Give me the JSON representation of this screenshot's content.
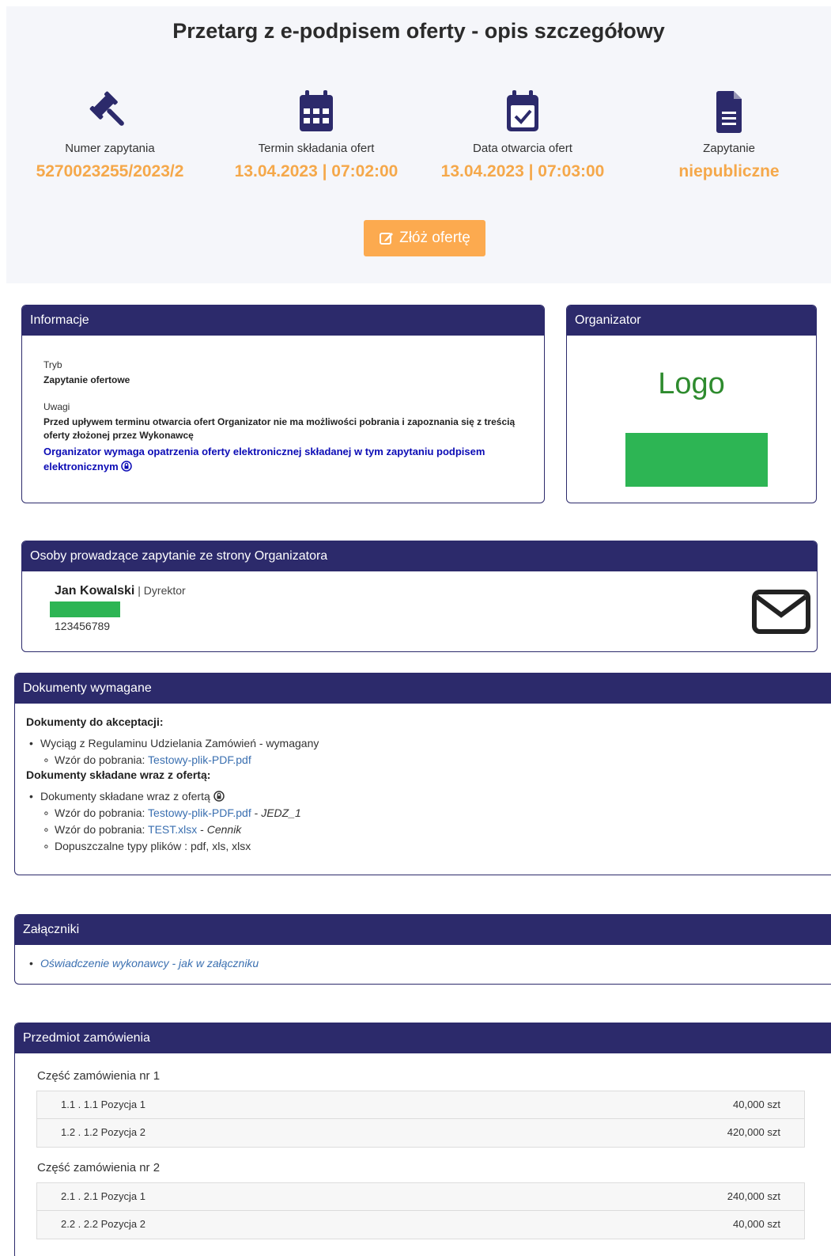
{
  "header": {
    "title": "Przetarg z e-podpisem oferty - opis szczegółowy",
    "stats": [
      {
        "icon": "gavel-icon",
        "label": "Numer zapytania",
        "value": "5270023255/2023/2"
      },
      {
        "icon": "calendar-icon",
        "label": "Termin składania ofert",
        "value": "13.04.2023 | 07:02:00"
      },
      {
        "icon": "calendar-check-icon",
        "label": "Data otwarcia ofert",
        "value": "13.04.2023 | 07:03:00"
      },
      {
        "icon": "document-icon",
        "label": "Zapytanie",
        "value": "niepubliczne"
      }
    ],
    "offer_button": "Złóż ofertę",
    "accent_color": "#f5a84a"
  },
  "info": {
    "title": "Informacje",
    "mode_label": "Tryb",
    "mode_value": "Zapytanie ofertowe",
    "notes_label": "Uwagi",
    "notes_line1": "Przed upływem terminu otwarcia ofert Organizator nie ma możliwości pobrania i zapoznania się z treścią",
    "notes_line2": "oferty złożonej przez Wykonawcę",
    "signature_line1": "Organizator wymaga opatrzenia oferty elektronicznej składanej w tym zapytaniu podpisem",
    "signature_line2": "elektronicznym"
  },
  "organizer": {
    "title": "Organizator",
    "logo_text": "Logo"
  },
  "contacts": {
    "title": "Osoby prowadzące zapytanie ze strony Organizatora",
    "name": "Jan Kowalski",
    "separator": " | ",
    "role": "Dyrektor",
    "phone": "123456789"
  },
  "documents": {
    "title": "Dokumenty wymagane",
    "accept_heading": "Dokumenty do akceptacji:",
    "accept_item": "Wyciąg z Regulaminu Udzielania Zamówień - wymagany",
    "template_prefix": "Wzór do pobrania: ",
    "accept_file": "Testowy-plik-PDF.pdf",
    "with_offer_heading": "Dokumenty składane wraz z ofertą:",
    "with_offer_item": "Dokumenty składane wraz z ofertą",
    "file1": "Testowy-plik-PDF.pdf",
    "file1_desc": "JEDZ_1",
    "file2": "TEST.xlsx",
    "file2_desc": "Cennik",
    "dash": " - ",
    "allowed_types": "Dopuszczalne typy plików : pdf, xls, xlsx"
  },
  "attachments": {
    "title": "Załączniki",
    "item": "Oświadczenie wykonawcy - jak w załączniku"
  },
  "order": {
    "title": "Przedmiot zamówienia",
    "parts": [
      {
        "title": "Część zamówienia nr 1",
        "rows": [
          {
            "name": "1.1 . 1.1 Pozycja 1",
            "qty": "40,000 szt"
          },
          {
            "name": "1.2 . 1.2 Pozycja 2",
            "qty": "420,000 szt"
          }
        ]
      },
      {
        "title": "Część zamówienia nr 2",
        "rows": [
          {
            "name": "2.1 . 2.1 Pozycja 1",
            "qty": "240,000 szt"
          },
          {
            "name": "2.2 . 2.2 Pozycja 2",
            "qty": "40,000 szt"
          }
        ]
      }
    ]
  },
  "colors": {
    "navy": "#2c2a6b",
    "orange_button": "#fcaa4f",
    "green_redaction": "#2db554",
    "link_blue": "#3a6fb0",
    "signature_blue": "#0b0bb5"
  }
}
